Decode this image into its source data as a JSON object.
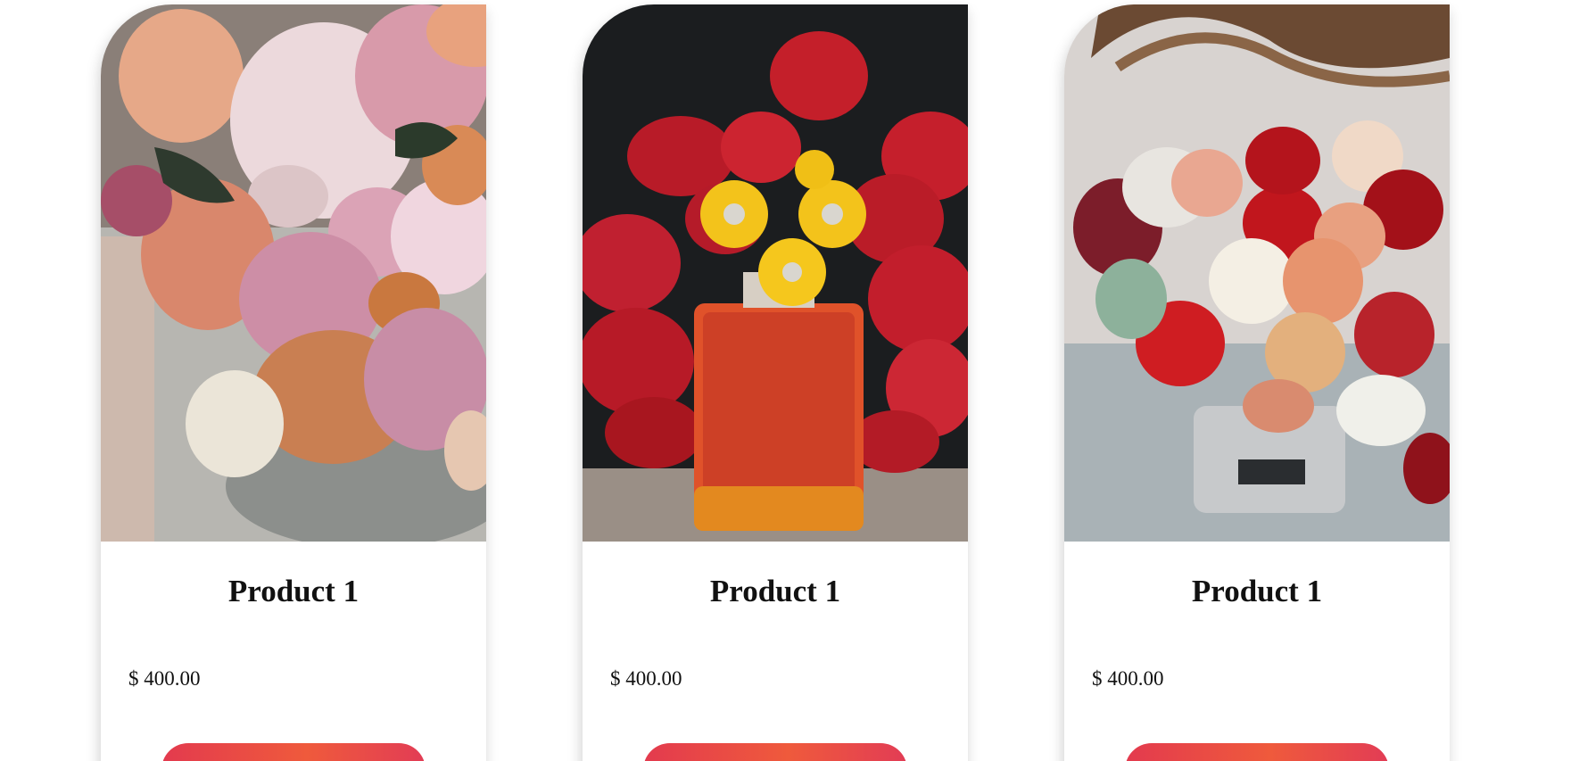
{
  "products": [
    {
      "name": "Product 1",
      "price": "$ 400.00",
      "image": "mixed pink peony and orange rose bouquet",
      "button_label": ""
    },
    {
      "name": "Product 1",
      "price": "$ 400.00",
      "image": "perfume bottle with yellow daisy cap in front of red tulips",
      "button_label": ""
    },
    {
      "name": "Product 1",
      "price": "$ 400.00",
      "image": "red and white rose arrangement in a grey box",
      "button_label": ""
    }
  ],
  "colors": {
    "button_gradient_start": "#e33a4e",
    "button_gradient_mid": "#ef5a3c",
    "text": "#111111"
  }
}
